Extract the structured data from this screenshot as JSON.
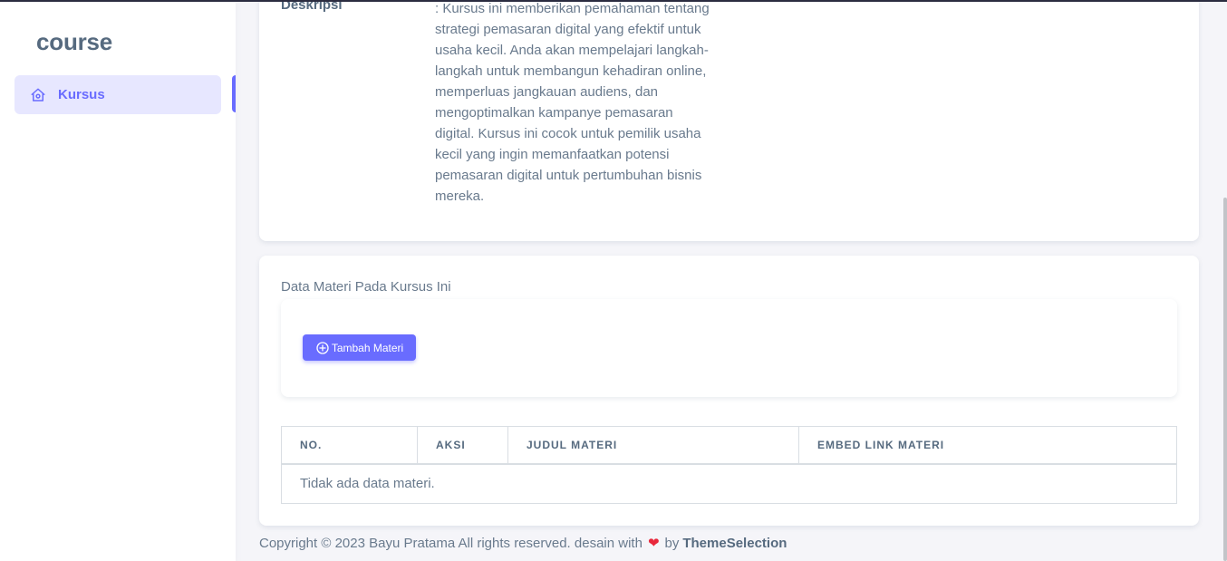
{
  "sidebar": {
    "brand": "course",
    "items": [
      {
        "label": "Kursus",
        "icon": "home-icon",
        "active": true
      }
    ]
  },
  "course": {
    "description_label": "Deskripsi",
    "description_text": ": Kursus ini memberikan pemahaman tentang strategi pemasaran digital yang efektif untuk usaha kecil. Anda akan mempelajari langkah-langkah untuk membangun kehadiran online, memperluas jangkauan audiens, dan mengoptimalkan kampanye pemasaran digital. Kursus ini cocok untuk pemilik usaha kecil yang ingin memanfaatkan potensi pemasaran digital untuk pertumbuhan bisnis mereka."
  },
  "materials": {
    "title": "Data Materi Pada Kursus Ini",
    "add_button": "Tambah Materi",
    "columns": [
      "NO.",
      "AKSI",
      "JUDUL MATERI",
      "EMBED LINK MATERI"
    ],
    "empty_text": "Tidak ada data materi."
  },
  "footer": {
    "text": "Copyright © 2023 Bayu Pratama All rights reserved. desain with",
    "by": "by",
    "brand": "ThemeSelection"
  },
  "colors": {
    "accent": "#696cff",
    "active_bg": "#e7e7ff",
    "heart": "#e8283c"
  }
}
